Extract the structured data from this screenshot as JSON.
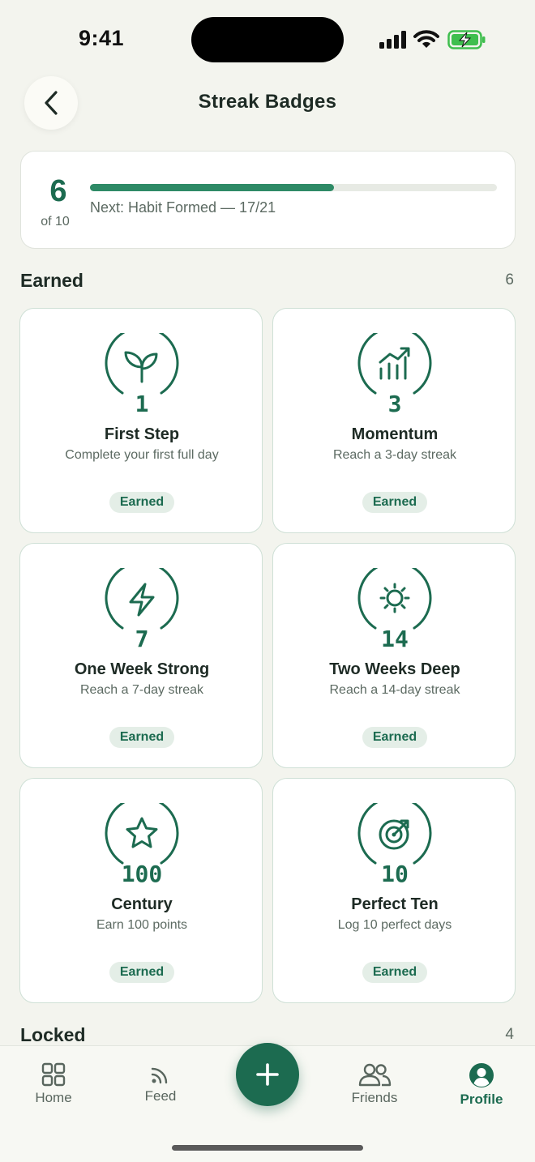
{
  "status_bar": {
    "time": "9:41"
  },
  "header": {
    "title": "Streak Badges"
  },
  "progress": {
    "earned_count": "6",
    "total_label": "of 10",
    "next_label": "Next: Habit Formed — 17/21",
    "fill_fraction": 0.6
  },
  "earned_section": {
    "title": "Earned",
    "count": "6"
  },
  "locked_section": {
    "title": "Locked",
    "count": "4"
  },
  "badges": [
    {
      "icon": "sprout-icon",
      "number": "1",
      "name": "First Step",
      "description": "Complete your first full day",
      "status": "Earned"
    },
    {
      "icon": "chart-up-icon",
      "number": "3",
      "name": "Momentum",
      "description": "Reach a 3-day streak",
      "status": "Earned"
    },
    {
      "icon": "bolt-icon",
      "number": "7",
      "name": "One Week Strong",
      "description": "Reach a 7-day streak",
      "status": "Earned"
    },
    {
      "icon": "sun-icon",
      "number": "14",
      "name": "Two Weeks Deep",
      "description": "Reach a 14-day streak",
      "status": "Earned"
    },
    {
      "icon": "star-icon",
      "number": "100",
      "name": "Century",
      "description": "Earn 100 points",
      "status": "Earned"
    },
    {
      "icon": "target-icon",
      "number": "10",
      "name": "Perfect Ten",
      "description": "Log 10 perfect days",
      "status": "Earned"
    }
  ],
  "tabbar": {
    "home": "Home",
    "feed": "Feed",
    "friends": "Friends",
    "profile": "Profile",
    "active": "profile"
  },
  "colors": {
    "accent": "#1c6b50",
    "progress": "#2e8a66",
    "background": "#f3f4ee"
  }
}
